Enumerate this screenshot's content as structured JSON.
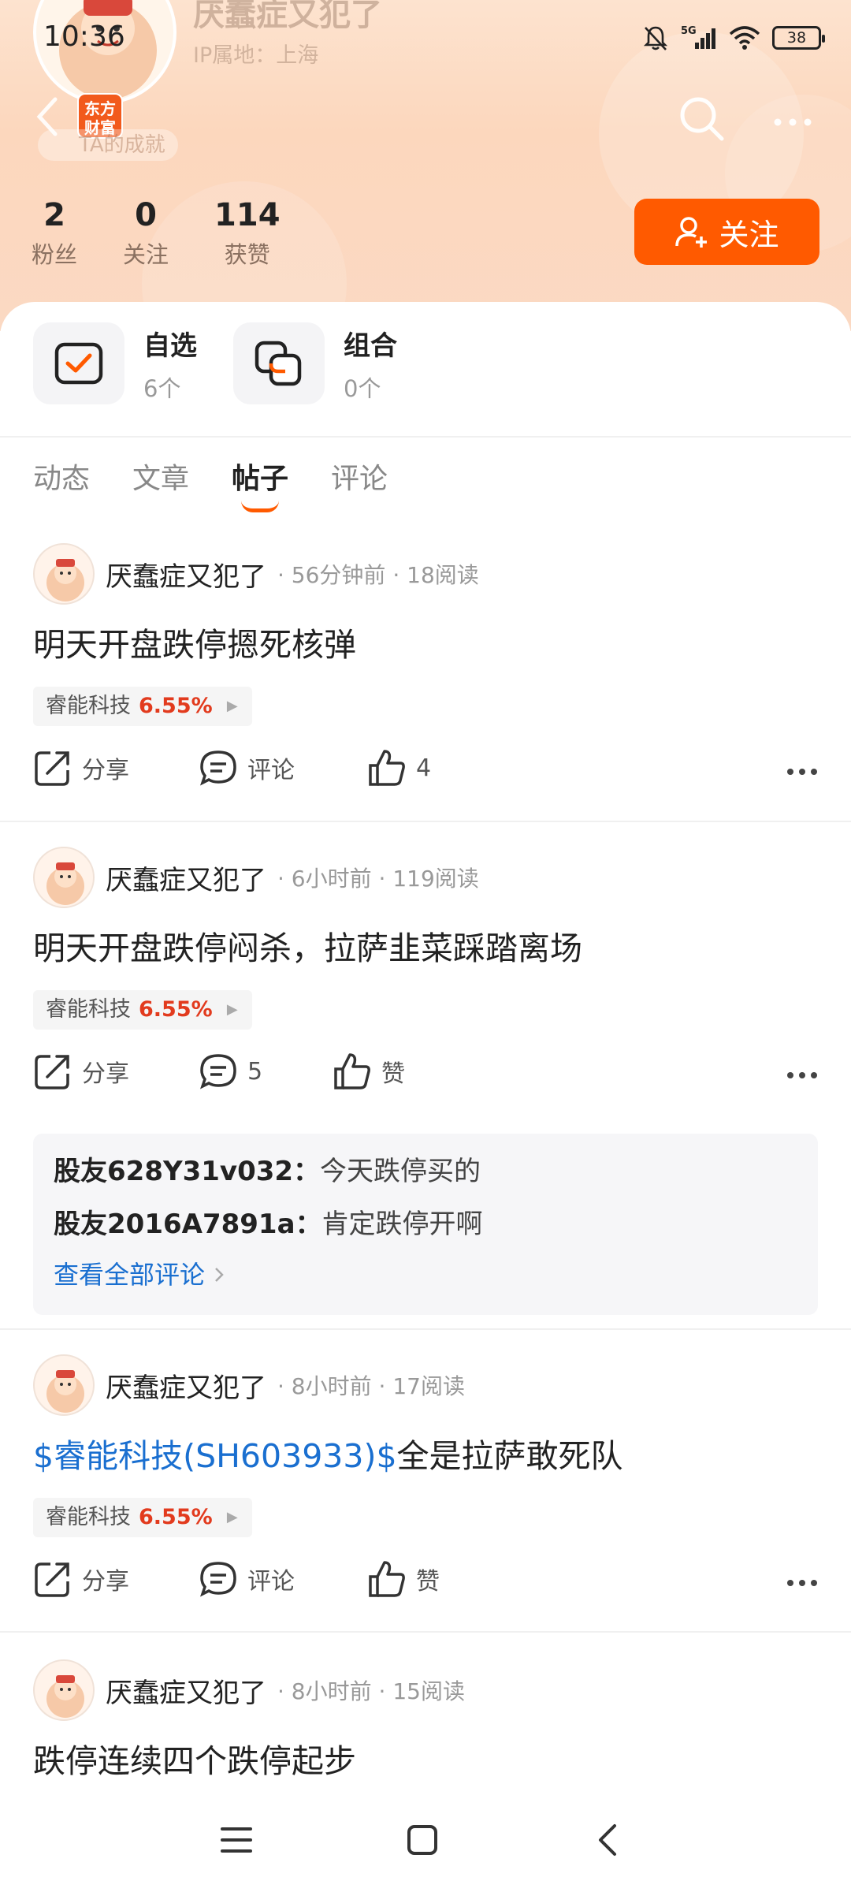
{
  "status_bar": {
    "time": "10:36",
    "battery": "38",
    "network": "5G"
  },
  "profile": {
    "username": "厌蠢症又犯了",
    "ip_location": "IP属地：上海",
    "brand_badge": "东方财富",
    "achievement_label": "TA的成就",
    "stats": [
      {
        "value": "2",
        "label": "粉丝"
      },
      {
        "value": "0",
        "label": "关注"
      },
      {
        "value": "114",
        "label": "获赞"
      }
    ],
    "follow_label": "关注"
  },
  "quick_links": [
    {
      "title": "自选",
      "count": "6个",
      "icon": "checkbox-icon"
    },
    {
      "title": "组合",
      "count": "0个",
      "icon": "portfolio-icon"
    }
  ],
  "tabs": [
    {
      "label": "动态",
      "active": false
    },
    {
      "label": "文章",
      "active": false
    },
    {
      "label": "帖子",
      "active": true
    },
    {
      "label": "评论",
      "active": false
    }
  ],
  "posts": [
    {
      "author": "厌蠢症又犯了",
      "meta": "· 56分钟前 · 18阅读",
      "title": "明天开盘跌停摁死核弹",
      "stock_name": "睿能科技",
      "stock_change": "6.55%",
      "share_label": "分享",
      "comment_label": "评论",
      "like_label": "4"
    },
    {
      "author": "厌蠢症又犯了",
      "meta": "· 6小时前 · 119阅读",
      "title": "明天开盘跌停闷杀，拉萨韭菜踩踏离场",
      "stock_name": "睿能科技",
      "stock_change": "6.55%",
      "share_label": "分享",
      "comment_label": "5",
      "like_label": "赞",
      "comments": [
        {
          "user": "股友628Y31v032：",
          "text": "今天跌停买的"
        },
        {
          "user": "股友2016A7891a：",
          "text": "肯定跌停开啊"
        }
      ],
      "see_all_label": "查看全部评论"
    },
    {
      "author": "厌蠢症又犯了",
      "meta": "· 8小时前 · 17阅读",
      "title_link": "$睿能科技(SH603933)$",
      "title_rest": "全是拉萨敢死队",
      "stock_name": "睿能科技",
      "stock_change": "6.55%",
      "share_label": "分享",
      "comment_label": "评论",
      "like_label": "赞"
    },
    {
      "author": "厌蠢症又犯了",
      "meta": "· 8小时前 · 15阅读",
      "title": "跌停连续四个跌停起步"
    }
  ],
  "colors": {
    "accent": "#ff5a00",
    "link": "#1a6fd0",
    "gain": "#e23b1e"
  }
}
